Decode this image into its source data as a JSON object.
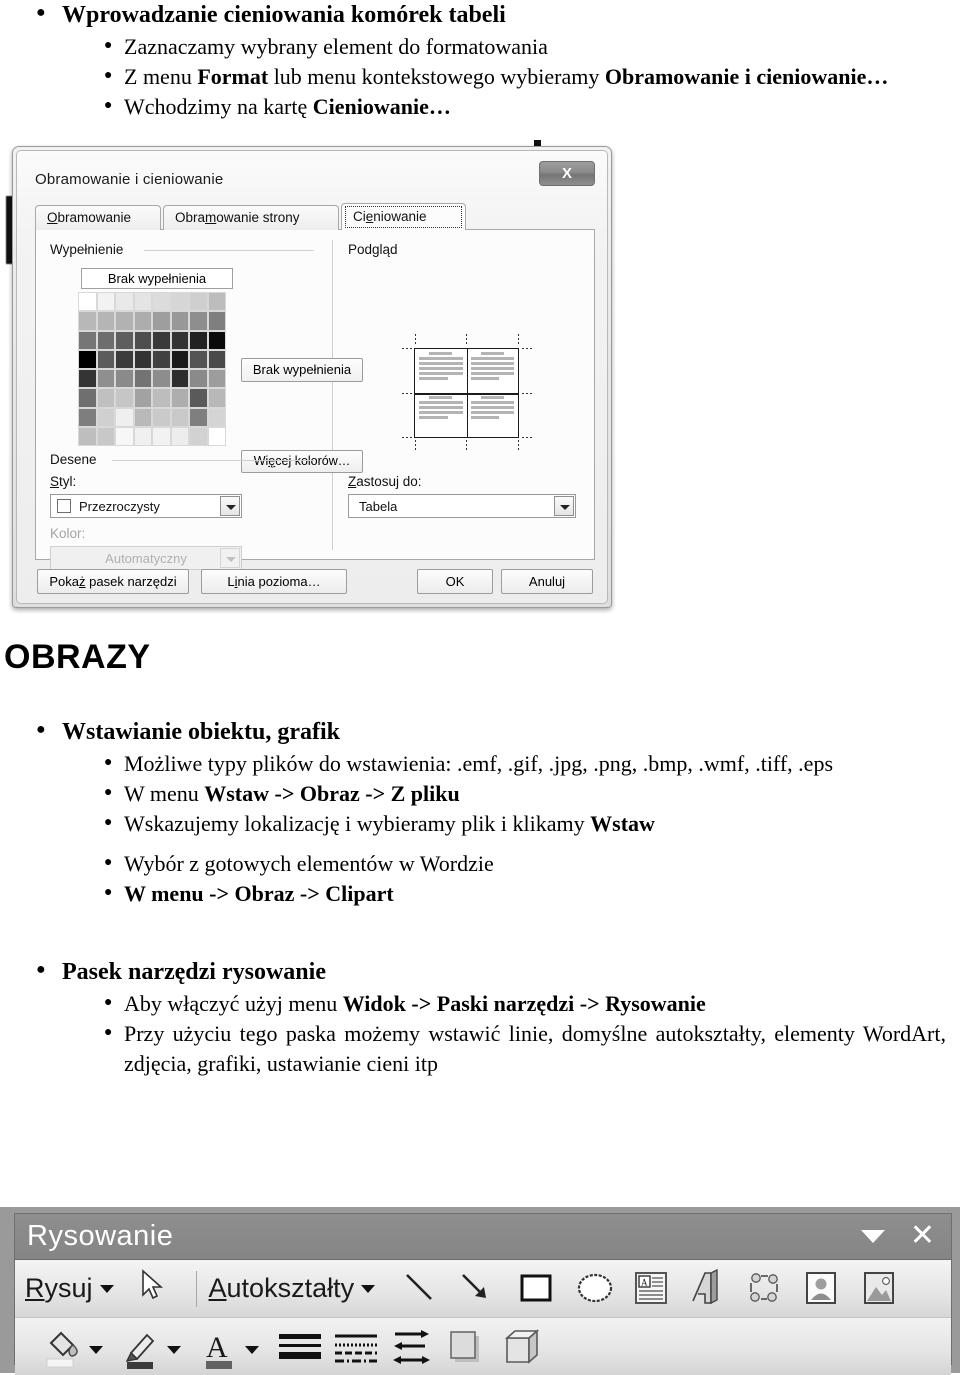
{
  "slide1": {
    "bullet_main": "Wprowadzanie cieniowania komórek tabeli",
    "sub": [
      "Zaznaczamy wybrany element do formatowania",
      "Z menu Format lub menu kontekstowego wybieramy Obramowanie i cieniowanie…",
      "Wchodzimy na kartę Cieniowanie…"
    ]
  },
  "dialog": {
    "title": "Obramowanie i cieniowanie",
    "close_label": "X",
    "tabs": [
      {
        "label": "Obramowanie",
        "underline": "O",
        "active": false
      },
      {
        "label": "Obramowanie strony",
        "underline": "m",
        "active": false
      },
      {
        "label": "Cieniowanie",
        "underline": "e",
        "active": true
      }
    ],
    "fill_group_label": "Wypełnienie",
    "no_fill_button_top": "Brak wypełnienia",
    "no_fill_button_mid": "Brak wypełnienia",
    "more_colors_button": "Więcej kolorów…",
    "patterns_group_label": "Desene",
    "style_label": "Styl:",
    "style_value": "Przezroczysty",
    "color_label": "Kolor:",
    "color_value": "Automatyczny",
    "preview_label": "Podgląd",
    "apply_to_label": "Zastosuj do:",
    "apply_to_value": "Tabela",
    "buttons": {
      "show_toolbar": "Pokaż pasek narzędzi",
      "horizontal_line": "Linia pozioma…",
      "ok": "OK",
      "cancel": "Anuluj"
    },
    "swatch_grid": {
      "rows": 8,
      "cols": 8,
      "colors": [
        [
          "#ffffff",
          "#f2f2f2",
          "#e9e9e9",
          "#e4e4e4",
          "#dcdcdc",
          "#d6d6d6",
          "#cfcfcf",
          "#bdbdbd"
        ],
        [
          "#b8b8b8",
          "#b5b5b5",
          "#b2b2b2",
          "#adadad",
          "#9e9e9e",
          "#989898",
          "#8e8e8e",
          "#7f7f7f"
        ],
        [
          "#767676",
          "#6d6d6d",
          "#5e5e5e",
          "#4e4e4e",
          "#3a3a3a",
          "#333333",
          "#222222",
          "#0a0a0a"
        ],
        [
          "#000000",
          "#5c5c5c",
          "#3c3c3c",
          "#333333",
          "#414141",
          "#191919",
          "#545454",
          "#4a4a4a"
        ],
        [
          "#343434",
          "#8f8f8f",
          "#8a8a8a",
          "#737373",
          "#8d8d8d",
          "#2e2e2e",
          "#8a8a8a",
          "#9d9d9d"
        ],
        [
          "#6f6f6f",
          "#c0c0c0",
          "#c6c6c6",
          "#a2a2a2",
          "#bdbdbd",
          "#aeaeae",
          "#5a5a5a",
          "#b8b8b8"
        ],
        [
          "#7e7e7e",
          "#d0d0d0",
          "#efefef",
          "#b9b9b9",
          "#cacaca",
          "#c9c9c9",
          "#7f7f7f",
          "#d4d4d4"
        ],
        [
          "#bebebe",
          "#c8c8c8",
          "#f7f7f7",
          "#f0f0f0",
          "#f2f2f2",
          "#ededed",
          "#d2d2d2",
          "#ffffff"
        ]
      ]
    }
  },
  "slide2": {
    "section_title": "OBRAZY",
    "group1_title": "Wstawianie obiektu, grafik",
    "group1_items": [
      "Możliwe typy plików do wstawienia: .emf, .gif, .jpg, .png, .bmp, .wmf, .tiff, .eps",
      "W menu Wstaw -> Obraz -> Z pliku",
      "Wskazujemy lokalizację i wybieramy plik i klikamy Wstaw",
      "Wybór z gotowych elementów w Wordzie",
      "W menu -> Obraz -> Clipart"
    ],
    "group2_title": "Pasek narzędzi rysowanie",
    "group2_items": [
      "Aby włączyć użyj menu Widok -> Paski narzędzi -> Rysowanie",
      "Przy użyciu tego paska możemy wstawić linie, domyślne autokształty, elementy WordArt, zdjęcia, grafiki, ustawianie cieni itp"
    ]
  },
  "toolbar": {
    "title": "Rysowanie",
    "caret_label": "▼",
    "close_label": "✕",
    "draw_menu": "Rysuj",
    "autoshapes_menu": "Autokształty",
    "row1_icons": [
      "select-objects-icon",
      "line-icon",
      "arrow-icon",
      "rectangle-icon",
      "oval-icon",
      "text-box-icon",
      "wordart-icon",
      "diagram-icon",
      "clipart-icon",
      "picture-icon"
    ],
    "row2_icons": [
      "fill-color-icon",
      "fill-color-dropdown",
      "line-color-icon",
      "line-color-dropdown",
      "font-color-icon",
      "font-color-dropdown",
      "line-style-icon",
      "dash-style-icon",
      "arrow-style-icon",
      "shadow-style-icon",
      "3d-style-icon"
    ]
  },
  "colors": {
    "toolbar_bg": "#9a9a9a",
    "toolbar_title_bg": "#8a8a8a",
    "dialog_bg": "#f0f0f0",
    "text": "#000000"
  }
}
